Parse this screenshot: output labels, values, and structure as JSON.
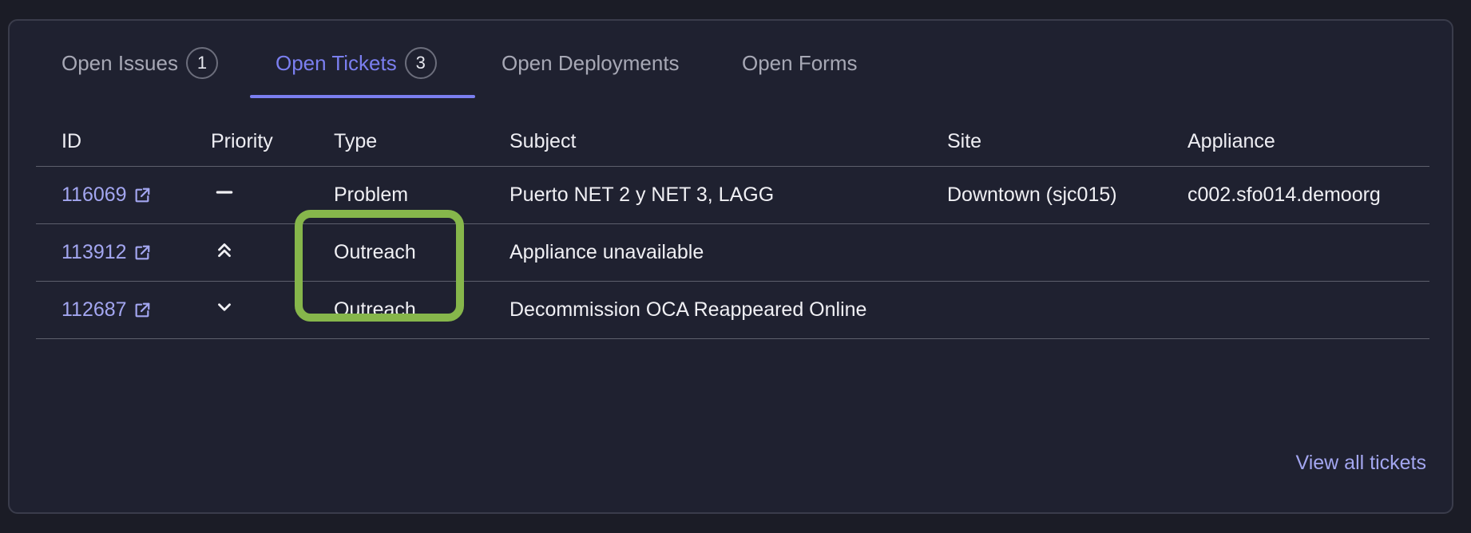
{
  "tabs": [
    {
      "label": "Open Issues",
      "count": "1",
      "active": false
    },
    {
      "label": "Open Tickets",
      "count": "3",
      "active": true
    },
    {
      "label": "Open Deployments",
      "count": null,
      "active": false
    },
    {
      "label": "Open Forms",
      "count": null,
      "active": false
    }
  ],
  "table": {
    "headers": [
      "ID",
      "Priority",
      "Type",
      "Subject",
      "Site",
      "Appliance"
    ],
    "rows": [
      {
        "id": "116069",
        "priority_icon": "priority-medium-icon",
        "type": "Problem",
        "subject": "Puerto NET 2 y NET 3, LAGG",
        "site": "Downtown (sjc015)",
        "appliance": "c002.sfo014.demoorg"
      },
      {
        "id": "113912",
        "priority_icon": "priority-high-icon",
        "type": "Outreach",
        "subject": "Appliance unavailable",
        "site": "",
        "appliance": ""
      },
      {
        "id": "112687",
        "priority_icon": "priority-low-icon",
        "type": "Outreach",
        "subject": "Decommission OCA Reappeared Online",
        "site": "",
        "appliance": ""
      }
    ]
  },
  "footer": {
    "view_all_label": "View all tickets"
  },
  "colors": {
    "accent": "#7b7ff0",
    "link": "#a3a6f0",
    "highlight": "#86b64b",
    "background": "#1f2130"
  },
  "icons": {
    "external_link": "external-link-icon"
  }
}
